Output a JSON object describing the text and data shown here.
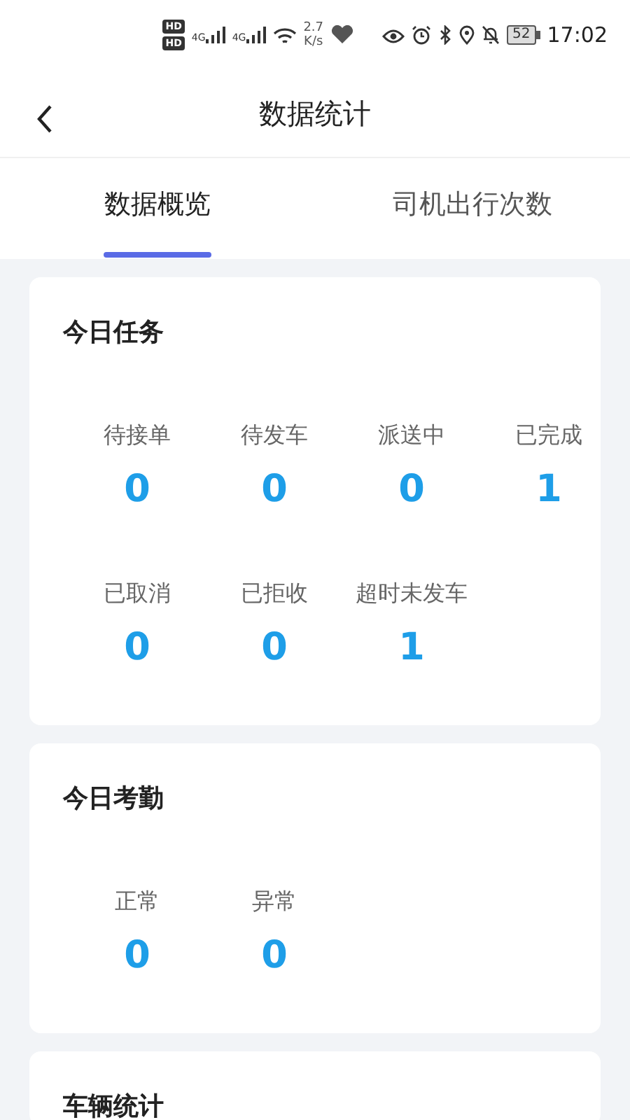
{
  "status_bar": {
    "hd_badges": [
      "HD",
      "HD"
    ],
    "signals": [
      "4G",
      "4G"
    ],
    "speed_value": "2.7",
    "speed_unit": "K/s",
    "battery": "52",
    "time": "17:02"
  },
  "header": {
    "title": "数据统计"
  },
  "tabs": [
    {
      "label": "数据概览",
      "selected": true
    },
    {
      "label": "司机出行次数",
      "selected": false
    }
  ],
  "cards": [
    {
      "title": "今日任务",
      "stats": [
        {
          "label": "待接单",
          "value": "0"
        },
        {
          "label": "待发车",
          "value": "0"
        },
        {
          "label": "派送中",
          "value": "0"
        },
        {
          "label": "已完成",
          "value": "1"
        },
        {
          "label": "已取消",
          "value": "0"
        },
        {
          "label": "已拒收",
          "value": "0"
        },
        {
          "label": "超时未发车",
          "value": "1"
        }
      ]
    },
    {
      "title": "今日考勤",
      "stats": [
        {
          "label": "正常",
          "value": "0"
        },
        {
          "label": "异常",
          "value": "0"
        }
      ]
    },
    {
      "title": "车辆统计"
    }
  ]
}
